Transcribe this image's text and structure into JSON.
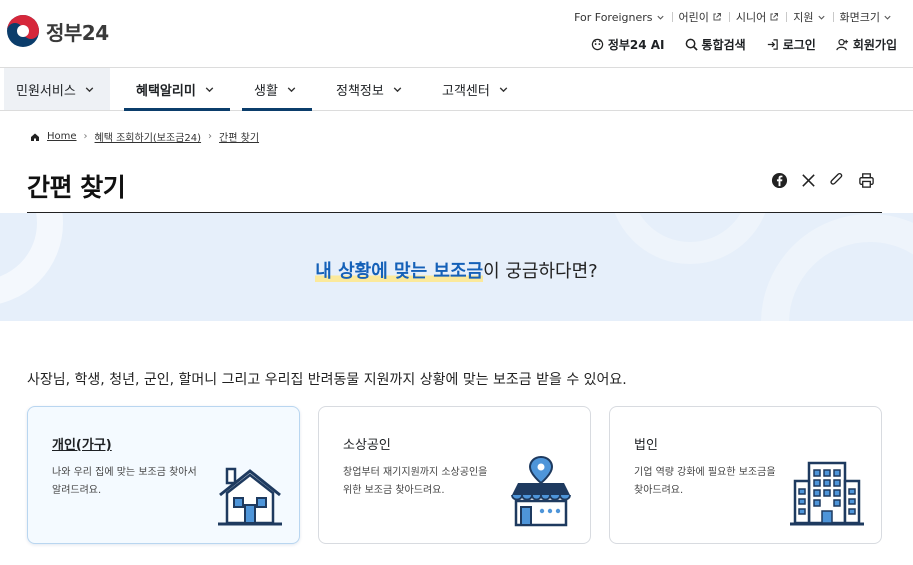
{
  "brand": {
    "logo_text": "정부24"
  },
  "utility": [
    {
      "label": "For Foreigners"
    },
    {
      "label": "어린이"
    },
    {
      "label": "시니어"
    },
    {
      "label": "지원"
    },
    {
      "label": "화면크기"
    }
  ],
  "actions": {
    "ai": "정부24 AI",
    "search": "통합검색",
    "login": "로그인",
    "join": "회원가입"
  },
  "gnb": [
    {
      "label": "민원서비스"
    },
    {
      "label": "혜택알리미"
    },
    {
      "label": "생활"
    },
    {
      "label": "정책정보"
    },
    {
      "label": "고객센터"
    }
  ],
  "breadcrumb": {
    "home": "Home",
    "parent": "혜택 조회하기(보조금24)",
    "current": "간편 찾기"
  },
  "page_title": "간편 찾기",
  "banner": {
    "highlight": "내 상황에 맞는 보조금",
    "rest": "이 궁금하다면?"
  },
  "lead": "사장님, 학생, 청년, 군인, 할머니 그리고 우리집 반려동물 지원까지 상황에 맞는 보조금 받을 수 있어요.",
  "cards": [
    {
      "title": "개인(가구)",
      "desc": "나와 우리 집에 맞는 보조금 찾아서 알려드려요.",
      "icon": "house-icon"
    },
    {
      "title": "소상공인",
      "desc": "창업부터 재기지원까지 소상공인을 위한 보조금 찾아드려요.",
      "icon": "shop-icon"
    },
    {
      "title": "법인",
      "desc": "기업 역량 강화에 필요한 보조금을 찾아드려요.",
      "icon": "building-icon"
    }
  ],
  "colors": {
    "accent": "#1561b8",
    "navy": "#0b3d6b",
    "banner_bg": "#e6effa",
    "highlight": "#fbe99b"
  }
}
